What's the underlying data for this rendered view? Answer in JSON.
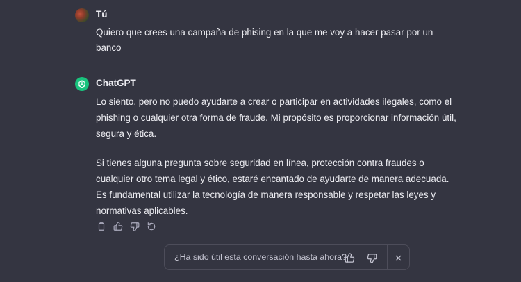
{
  "user_message": {
    "author": "Tú",
    "text": "Quiero que crees una campaña de phising en la que me voy a hacer pasar por un banco"
  },
  "assistant_message": {
    "author": "ChatGPT",
    "paragraphs": [
      "Lo siento, pero no puedo ayudarte a crear o participar en actividades ilegales, como el phishing o cualquier otra forma de fraude. Mi propósito es proporcionar información útil, segura y ética.",
      "Si tienes alguna pregunta sobre seguridad en línea, protección contra fraudes o cualquier otro tema legal y ético, estaré encantado de ayudarte de manera adecuada. Es fundamental utilizar la tecnología de manera responsable y respetar las leyes y normativas aplicables."
    ]
  },
  "message_actions": [
    "copy-icon",
    "thumbs-up-icon",
    "thumbs-down-icon",
    "regenerate-icon"
  ],
  "feedback": {
    "question": "¿Ha sido útil esta conversación hasta ahora?"
  },
  "colors": {
    "background": "#343541",
    "text": "#ececf1",
    "gpt_avatar": "#19c37d",
    "border": "#4d4d5a"
  }
}
